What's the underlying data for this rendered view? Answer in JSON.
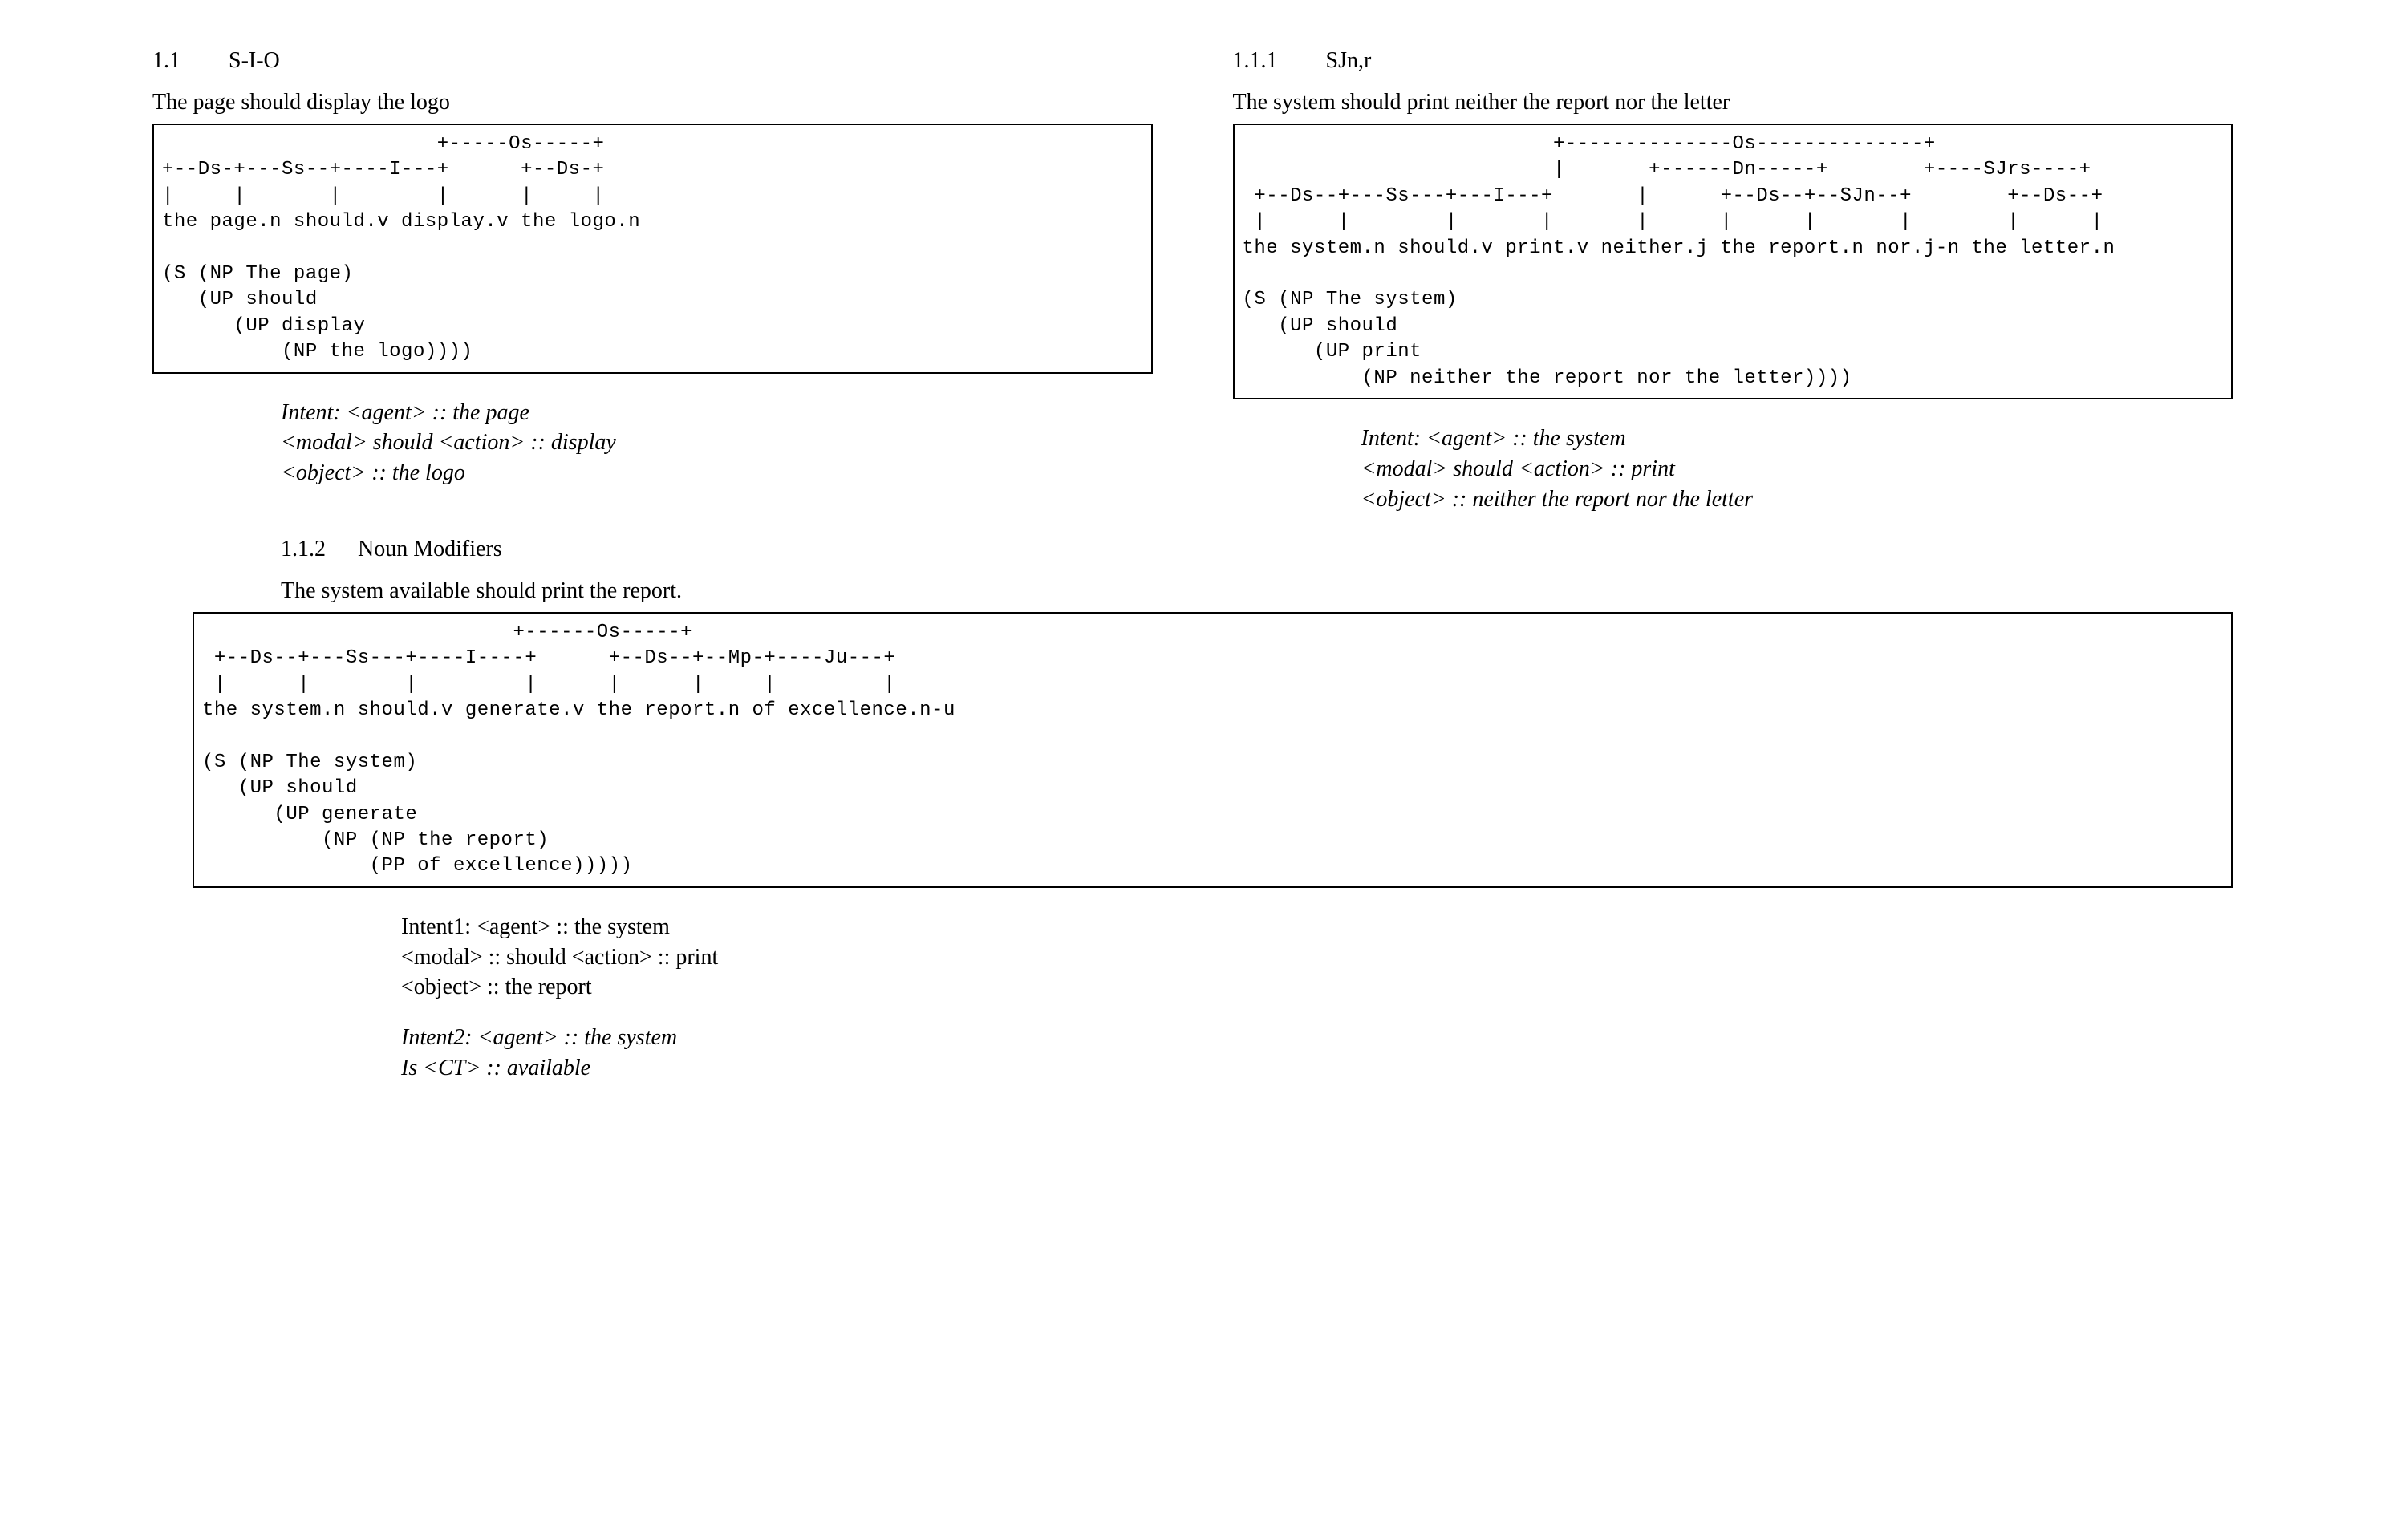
{
  "left": {
    "heading_num": "1.1",
    "heading_title": "S-I-O",
    "sentence": "The page should display the logo",
    "code": "                       +-----Os-----+\n+--Ds-+---Ss--+----I---+      +--Ds-+\n|     |       |        |      |     |\nthe page.n should.v display.v the logo.n\n\n(S (NP The page)\n   (UP should\n      (UP display\n          (NP the logo))))",
    "intent_l1": "Intent: <agent> :: the page",
    "intent_l2": "<modal> should <action> :: display",
    "intent_l3": "<object> :: the logo"
  },
  "right": {
    "heading_num": "1.1.1",
    "heading_title": "SJn,r",
    "sentence": "The system should print neither the report nor the letter",
    "code": "                          +--------------Os--------------+\n                          |       +------Dn-----+        +----SJrs----+\n +--Ds--+---Ss---+---I---+       |      +--Ds--+--SJn--+        +--Ds--+\n |      |        |       |       |      |      |       |        |      |\nthe system.n should.v print.v neither.j the report.n nor.j-n the letter.n\n\n(S (NP The system)\n   (UP should\n      (UP print\n          (NP neither the report nor the letter))))",
    "intent_l1": "Intent: <agent> :: the system",
    "intent_l2": "<modal> should <action> :: print",
    "intent_l3": "<object> :: neither the report nor the letter"
  },
  "sec2": {
    "heading_num": "1.1.2",
    "heading_title": "Noun Modifiers",
    "sentence": "The system available should print the report.",
    "code": "                          +------Os-----+\n +--Ds--+---Ss---+----I----+      +--Ds--+--Mp-+----Ju---+\n |      |        |         |      |      |     |         |\nthe system.n should.v generate.v the report.n of excellence.n-u\n\n(S (NP The system)\n   (UP should\n      (UP generate\n          (NP (NP the report)\n              (PP of excellence)))))",
    "intent1_l1": "Intent1: <agent> :: the system",
    "intent1_l2": "<modal> :: should <action> :: print",
    "intent1_l3": "<object> :: the report",
    "intent2_l1": "Intent2: <agent> :: the system",
    "intent2_l2": "Is <CT> :: available"
  }
}
